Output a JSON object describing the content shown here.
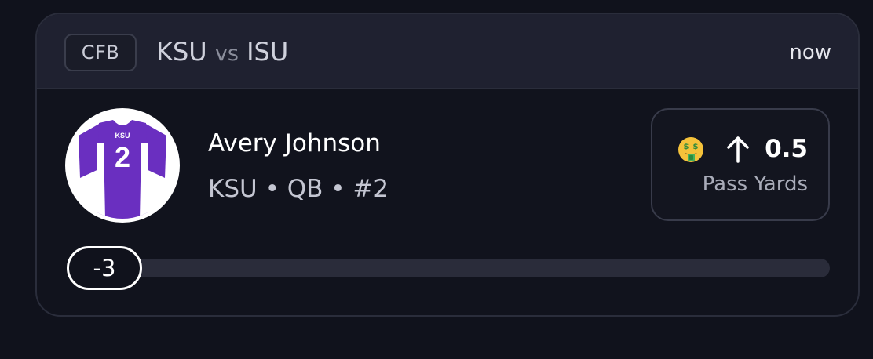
{
  "header": {
    "league": "CFB",
    "home_team": "KSU",
    "vs": "vs",
    "away_team": "ISU",
    "time": "now"
  },
  "player": {
    "name": "Avery Johnson",
    "team": "KSU",
    "sep1": "•",
    "position": "QB",
    "sep2": "•",
    "number": "#2",
    "jersey_text": "KSU",
    "jersey_number": "2"
  },
  "prop": {
    "emoji": "money-mouth-face-icon",
    "direction": "up-arrow-icon",
    "line": "0.5",
    "stat": "Pass Yards"
  },
  "progress": {
    "current_value": "-3",
    "fill_fraction": 0.0
  },
  "colors": {
    "background": "#10121c",
    "header": "#1f2130",
    "jersey_purple": "#6a2fc0",
    "track": "#2a2c3a"
  }
}
